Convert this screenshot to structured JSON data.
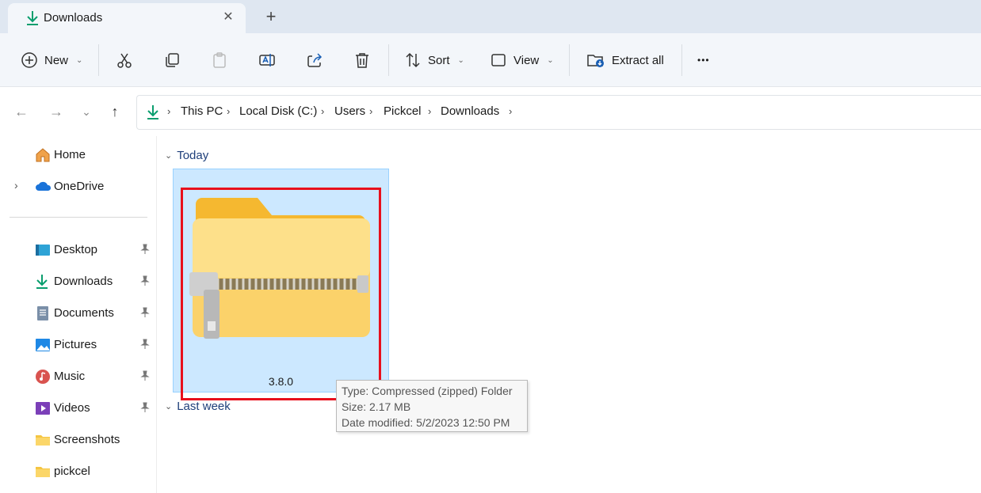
{
  "tab": {
    "title": "Downloads",
    "close_glyph": "✕",
    "new_tab_glyph": "+"
  },
  "toolbar": {
    "new_label": "New",
    "sort_label": "Sort",
    "view_label": "View",
    "extract_label": "Extract all",
    "more_glyph": "•••"
  },
  "breadcrumb": [
    "This PC",
    "Local Disk (C:)",
    "Users",
    "Pickcel",
    "Downloads"
  ],
  "sidebar": {
    "top_items": [
      {
        "label": "Home",
        "icon": "home-icon"
      },
      {
        "label": "OneDrive",
        "icon": "onedrive-icon"
      }
    ],
    "quick_access": [
      {
        "label": "Desktop",
        "icon": "desktop-icon",
        "pinned": true
      },
      {
        "label": "Downloads",
        "icon": "downloads-icon",
        "pinned": true
      },
      {
        "label": "Documents",
        "icon": "documents-icon",
        "pinned": true
      },
      {
        "label": "Pictures",
        "icon": "pictures-icon",
        "pinned": true
      },
      {
        "label": "Music",
        "icon": "music-icon",
        "pinned": true
      },
      {
        "label": "Videos",
        "icon": "videos-icon",
        "pinned": true
      },
      {
        "label": "Screenshots",
        "icon": "folder-icon",
        "pinned": false
      },
      {
        "label": "pickcel",
        "icon": "folder-icon",
        "pinned": false
      }
    ]
  },
  "content": {
    "groups": [
      "Today",
      "Last week"
    ],
    "file": {
      "name": "3.8.0",
      "icon": "zip-folder-icon"
    },
    "tooltip": {
      "type": "Type: Compressed (zipped) Folder",
      "size": "Size: 2.17 MB",
      "modified": "Date modified: 5/2/2023 12:50 PM"
    }
  },
  "colors": {
    "accent": "#0a9e6e",
    "selection": "#cce8ff",
    "highlight": "#e8101c",
    "group_header": "#1f3f7a"
  }
}
